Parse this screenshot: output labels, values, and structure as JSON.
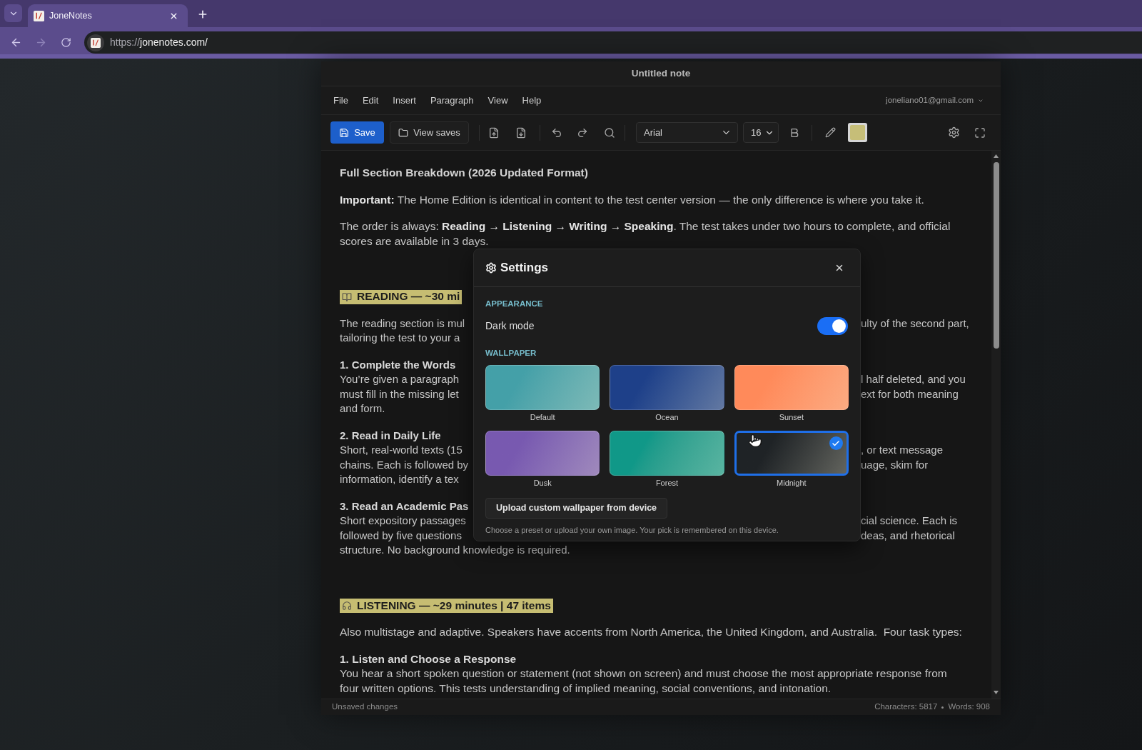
{
  "browser": {
    "tab": {
      "title": "JoneNotes"
    },
    "address": {
      "scheme": "https://",
      "host": "jonenotes.com/"
    }
  },
  "app": {
    "title": "Untitled note",
    "menu": [
      "File",
      "Edit",
      "Insert",
      "Paragraph",
      "View",
      "Help"
    ],
    "account": "joneliano01@gmail.com",
    "toolbar": {
      "save": "Save",
      "view_saves": "View saves",
      "font": "Arial",
      "size": "16"
    },
    "document": {
      "blocks": [
        {
          "kind": "title",
          "text": "Full Section Breakdown (2026 Updated Format)"
        },
        {
          "kind": "paragraph",
          "text": "**Important:** The Home Edition is identical in content to the test center version — the only difference is where you take it."
        },
        {
          "kind": "paragraph",
          "text": "The order is always: **Reading → Listening → Writing → Speaking**. The test takes under two hours to complete, and official scores are available in 3 days."
        },
        {
          "kind": "section",
          "text": "READING — ~30 mi"
        },
        {
          "kind": "split",
          "lines": [
            {
              "left": "The reading section is mul",
              "right": "ulty of the second part,"
            },
            {
              "left": "tailoring the test to your a"
            }
          ]
        },
        {
          "kind": "split",
          "heading": "1. Complete the Words",
          "lines": [
            {
              "left": "You’re given a paragraph",
              "right": "l half deleted, and you"
            },
            {
              "left": "must fill in the missing let",
              "right": "ext for both meaning"
            },
            {
              "left": "and form."
            }
          ]
        },
        {
          "kind": "split",
          "heading": "2. Read in Daily Life",
          "lines": [
            {
              "left": "Short, real-world texts (15",
              "right": ", or text message"
            },
            {
              "left": "chains. Each is followed by",
              "right": "uage, skim for"
            },
            {
              "left": "information, identify a tex"
            }
          ]
        },
        {
          "kind": "split",
          "heading": "3. Read an Academic Pas",
          "lines": [
            {
              "left": "Short expository passages",
              "right": "cial science. Each is"
            },
            {
              "left": "followed by five questions",
              "right": "deas, and rhetorical"
            },
            {
              "left": "structure. No background knowledge is required."
            }
          ]
        },
        {
          "kind": "section",
          "text": "LISTENING — ~29 minutes | 47 items"
        },
        {
          "kind": "paragraph",
          "text": "Also multistage and adaptive. Speakers have accents from North America, the United Kingdom, and Australia.  Four task types:"
        },
        {
          "kind": "subsection",
          "heading": "1. Listen and Choose a Response",
          "text": "You hear a short spoken question or statement (not shown on screen) and must choose the most appropriate response from four written options. This tests understanding of implied meaning, social conventions, and intonation."
        }
      ]
    },
    "status_bar": {
      "state": "Unsaved changes",
      "stats": [
        "Characters: 5817",
        "Words: 908"
      ]
    }
  },
  "settings": {
    "title": "Settings",
    "appearance": {
      "heading": "APPEARANCE",
      "dark_mode": {
        "label": "Dark mode",
        "on": true
      }
    },
    "wallpaper": {
      "heading": "WALLPAPER",
      "presets": [
        {
          "label": "Default",
          "color": "#44a0a8",
          "selected": false
        },
        {
          "label": "Ocean",
          "color": "#1e4089",
          "selected": false
        },
        {
          "label": "Sunset",
          "color": "#ff8a5a",
          "selected": false
        },
        {
          "label": "Dusk",
          "color": "#7859b0",
          "selected": false
        },
        {
          "label": "Forest",
          "color": "#109888",
          "selected": false
        },
        {
          "label": "Midnight",
          "color": "#1f2326",
          "selected": true
        }
      ],
      "upload": "Upload custom wallpaper from device",
      "hint": "Choose a preset or upload your own image. Your pick is remembered on this device."
    }
  }
}
